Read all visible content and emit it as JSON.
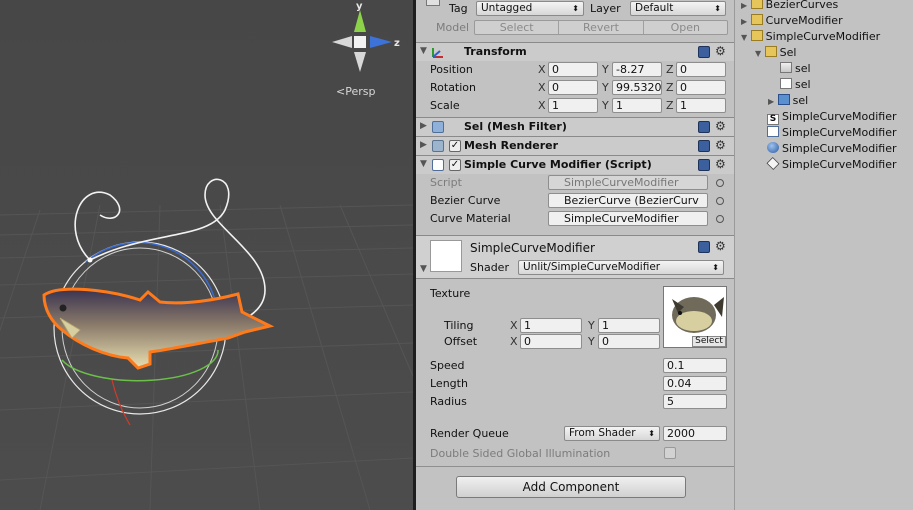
{
  "scene": {
    "persp_label": "Persp",
    "gizmo": {
      "y_label": "y",
      "z_label": "z"
    }
  },
  "inspector": {
    "tag_label": "Tag",
    "tag_value": "Untagged",
    "layer_label": "Layer",
    "layer_value": "Default",
    "model_label": "Model",
    "model_buttons": [
      "Select",
      "Revert",
      "Open"
    ],
    "transform": {
      "title": "Transform",
      "rows": [
        {
          "label": "Position",
          "x": "0",
          "y": "-8.27",
          "z": "0"
        },
        {
          "label": "Rotation",
          "x": "0",
          "y": "99.5320",
          "z": "0"
        },
        {
          "label": "Scale",
          "x": "1",
          "y": "1",
          "z": "1"
        }
      ],
      "axis": {
        "x": "X",
        "y": "Y",
        "z": "Z"
      }
    },
    "mesh_filter": {
      "title": "Sel (Mesh Filter)"
    },
    "mesh_renderer": {
      "title": "Mesh Renderer",
      "enabled": true
    },
    "script": {
      "title": "Simple Curve Modifier (Script)",
      "enabled": true,
      "rows": [
        {
          "label": "Script",
          "value": "SimpleCurveModifier"
        },
        {
          "label": "Bezier Curve",
          "value": "BezierCurve (BezierCurv"
        },
        {
          "label": "Curve Material",
          "value": "SimpleCurveModifier"
        }
      ]
    },
    "material": {
      "name": "SimpleCurveModifier",
      "shader_label": "Shader",
      "shader_value": "Unlit/SimpleCurveModifier",
      "texture_label": "Texture",
      "texture_select": "Select",
      "tiling_label": "Tiling",
      "tiling": {
        "x": "1",
        "y": "1"
      },
      "offset_label": "Offset",
      "offset": {
        "x": "0",
        "y": "0"
      },
      "speed_label": "Speed",
      "speed": "0.1",
      "length_label": "Length",
      "length": "0.04",
      "radius_label": "Radius",
      "radius": "5",
      "render_queue_label": "Render Queue",
      "render_queue_mode": "From Shader",
      "render_queue_value": "2000",
      "dsgi_label": "Double Sided Global Illumination"
    },
    "add_component": "Add Component"
  },
  "hierarchy": {
    "items": [
      {
        "label": "BezierCurves",
        "icon": "folder-icon",
        "expanded": false
      },
      {
        "label": "CurveModifier",
        "icon": "folder-icon",
        "expanded": false
      },
      {
        "label": "SimpleCurveModifier",
        "icon": "folder-icon",
        "expanded": true
      },
      {
        "label": "Sel",
        "icon": "folder-icon",
        "expanded": true
      },
      {
        "label": "sel",
        "icon": "mesh-icon"
      },
      {
        "label": "sel",
        "icon": "material-file-icon"
      },
      {
        "label": "sel",
        "icon": "prefab-icon",
        "expanded": false
      },
      {
        "label": "SimpleCurveModifier",
        "icon": "shader-icon"
      },
      {
        "label": "SimpleCurveModifier",
        "icon": "script-icon"
      },
      {
        "label": "SimpleCurveModifier",
        "icon": "material-sphere-icon"
      },
      {
        "label": "SimpleCurveModifier",
        "icon": "unity-scene-icon"
      }
    ]
  }
}
